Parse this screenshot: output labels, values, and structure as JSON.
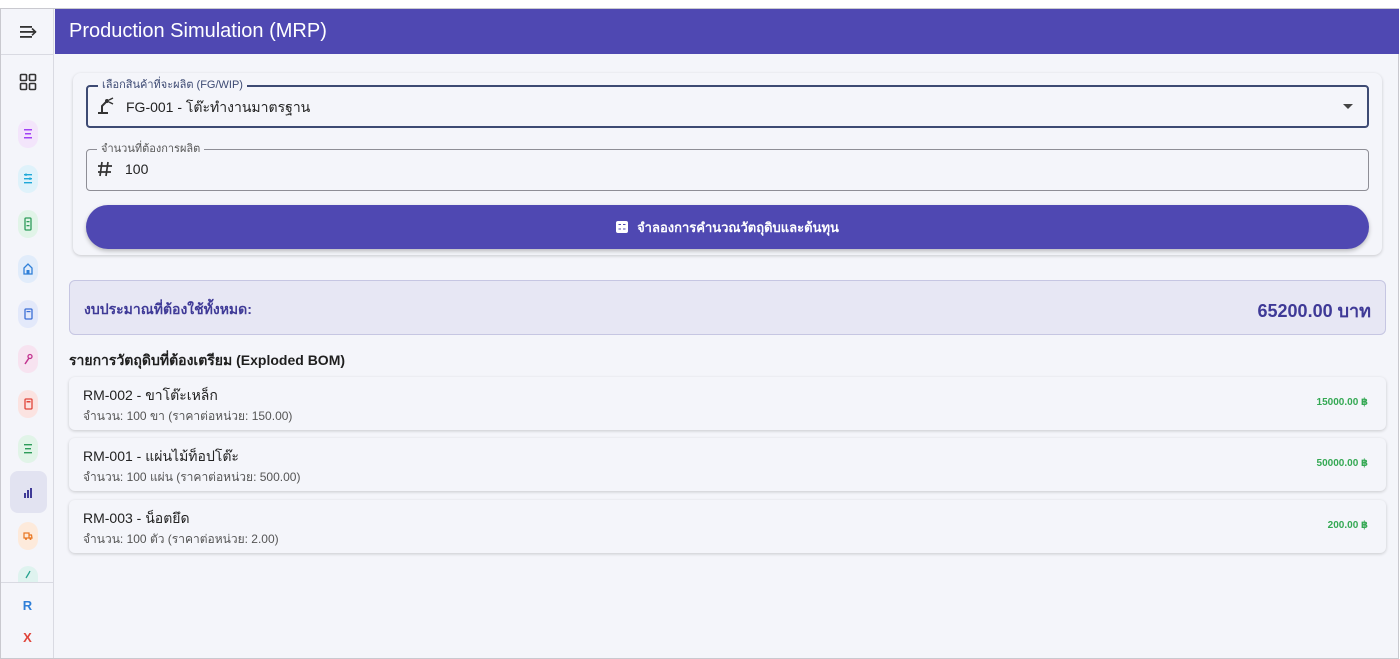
{
  "app": {
    "title": "Production Simulation (MRP)"
  },
  "sidebar": {
    "items": [
      {
        "icon": "dashboard-grid-icon"
      },
      {
        "icon": "list-icon",
        "color": "#a142f4",
        "bg": "#f3e5fb"
      },
      {
        "icon": "sliders-icon",
        "color": "#1fa8d8",
        "bg": "#dff2fa"
      },
      {
        "icon": "inventory-icon",
        "color": "#2e9c5a",
        "bg": "#e1f4e8"
      },
      {
        "icon": "warehouse-icon",
        "color": "#2f7fd8",
        "bg": "#e1ecfa"
      },
      {
        "icon": "document-icon",
        "color": "#3b6fd6",
        "bg": "#e3e9fa"
      },
      {
        "icon": "wrench-icon",
        "color": "#c2338f",
        "bg": "#f7e3f0"
      },
      {
        "icon": "receipt-icon",
        "color": "#e0443a",
        "bg": "#fbe3e1"
      },
      {
        "icon": "checklist-icon",
        "color": "#2e9c5a",
        "bg": "#e1f4e8"
      },
      {
        "icon": "bar-chart-icon",
        "color": "#3f3a97",
        "bg": "transparent",
        "active": true
      },
      {
        "icon": "truck-icon",
        "color": "#e8741f",
        "bg": "#fdeadb"
      },
      {
        "icon": "tool-icon",
        "color": "#27a38f",
        "bg": "#dff3ef"
      }
    ],
    "footer_r": "R",
    "footer_x": "X",
    "colors": {
      "r": "#2f7fd8",
      "x": "#e0443a"
    }
  },
  "form": {
    "product": {
      "label": "เลือกสินค้าที่จะผลิต (FG/WIP)",
      "value": "FG-001 - โต๊ะทำงานมาตรฐาน"
    },
    "quantity": {
      "label": "จำนวนที่ต้องการผลิต",
      "value": "100"
    },
    "simulate_button": "จำลองการคำนวณวัตถุดิบและต้นทุน"
  },
  "budget": {
    "label": "งบประมาณที่ต้องใช้ทั้งหมด:",
    "value": "65200.00 บาท"
  },
  "bom": {
    "title": "รายการวัตถุดิบที่ต้องเตรียม (Exploded BOM)",
    "items": [
      {
        "name": "RM-002 - ขาโต๊ะเหล็ก",
        "detail": "จำนวน: 100 ขา (ราคาต่อหน่วย: 150.00)",
        "total": "15000.00 ฿"
      },
      {
        "name": "RM-001 - แผ่นไม้ท็อปโต๊ะ",
        "detail": "จำนวน: 100 แผ่น (ราคาต่อหน่วย: 500.00)",
        "total": "50000.00 ฿"
      },
      {
        "name": "RM-003 - น็อตยึด",
        "detail": "จำนวน: 100 ตัว (ราคาต่อหน่วย: 2.00)",
        "total": "200.00 ฿"
      }
    ]
  },
  "colors": {
    "primary": "#4f48b2",
    "success": "#34a853",
    "budget_text": "#3f3a97"
  }
}
